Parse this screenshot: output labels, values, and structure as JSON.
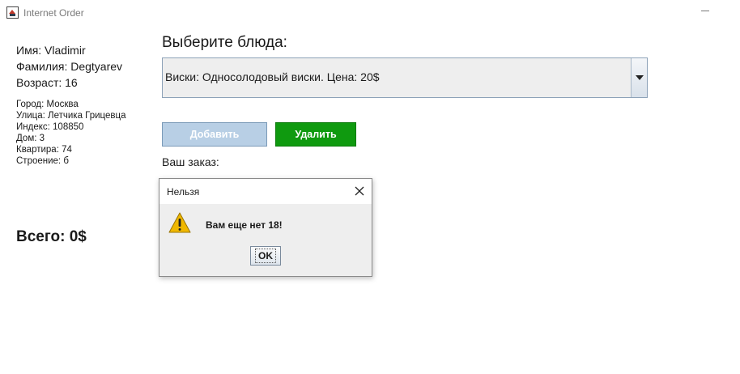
{
  "window": {
    "title": "Internet Order",
    "icon": "java-cup-icon"
  },
  "user": {
    "name": "Имя: Vladimir",
    "surname": "Фамилия: Degtyarev",
    "age": "Возраст: 16"
  },
  "address": {
    "city": "Город: Москва",
    "street": "Улица: Летчика Грицевца",
    "index": "Индекс: 108850",
    "house": "Дом: 3",
    "apartment": "Квартира: 74",
    "building": "Строение: б"
  },
  "total": "Всего: 0$",
  "order": {
    "choose_label": "Выберите блюда:",
    "selected_dish": "Виски: Односолодовый виски. Цена: 20$",
    "add_label": "Добавить",
    "delete_label": "Удалить",
    "your_order_label": "Ваш заказ:"
  },
  "dialog": {
    "title": "Нельзя",
    "message": "Вам еще нет 18!",
    "ok_label": "OK",
    "icon": "warning-icon"
  },
  "colors": {
    "delete_button": "#0f9a0f",
    "add_button_disabled": "#b8cfe5",
    "warning": "#f0b800"
  }
}
